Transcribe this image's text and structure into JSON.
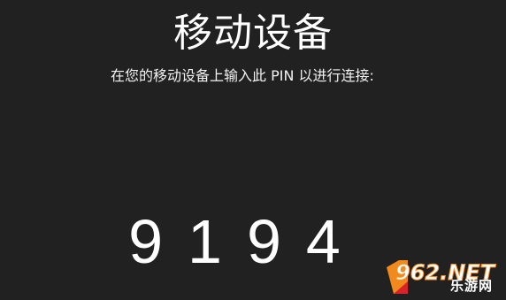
{
  "screen": {
    "title": "移动设备",
    "instruction": "在您的移动设备上输入此 PIN 以进行连接:",
    "pin": "9194"
  },
  "watermark": {
    "brand": "962.NET",
    "tagline": "乐游网"
  },
  "colors": {
    "background": "#212121",
    "text": "#ffffff"
  }
}
